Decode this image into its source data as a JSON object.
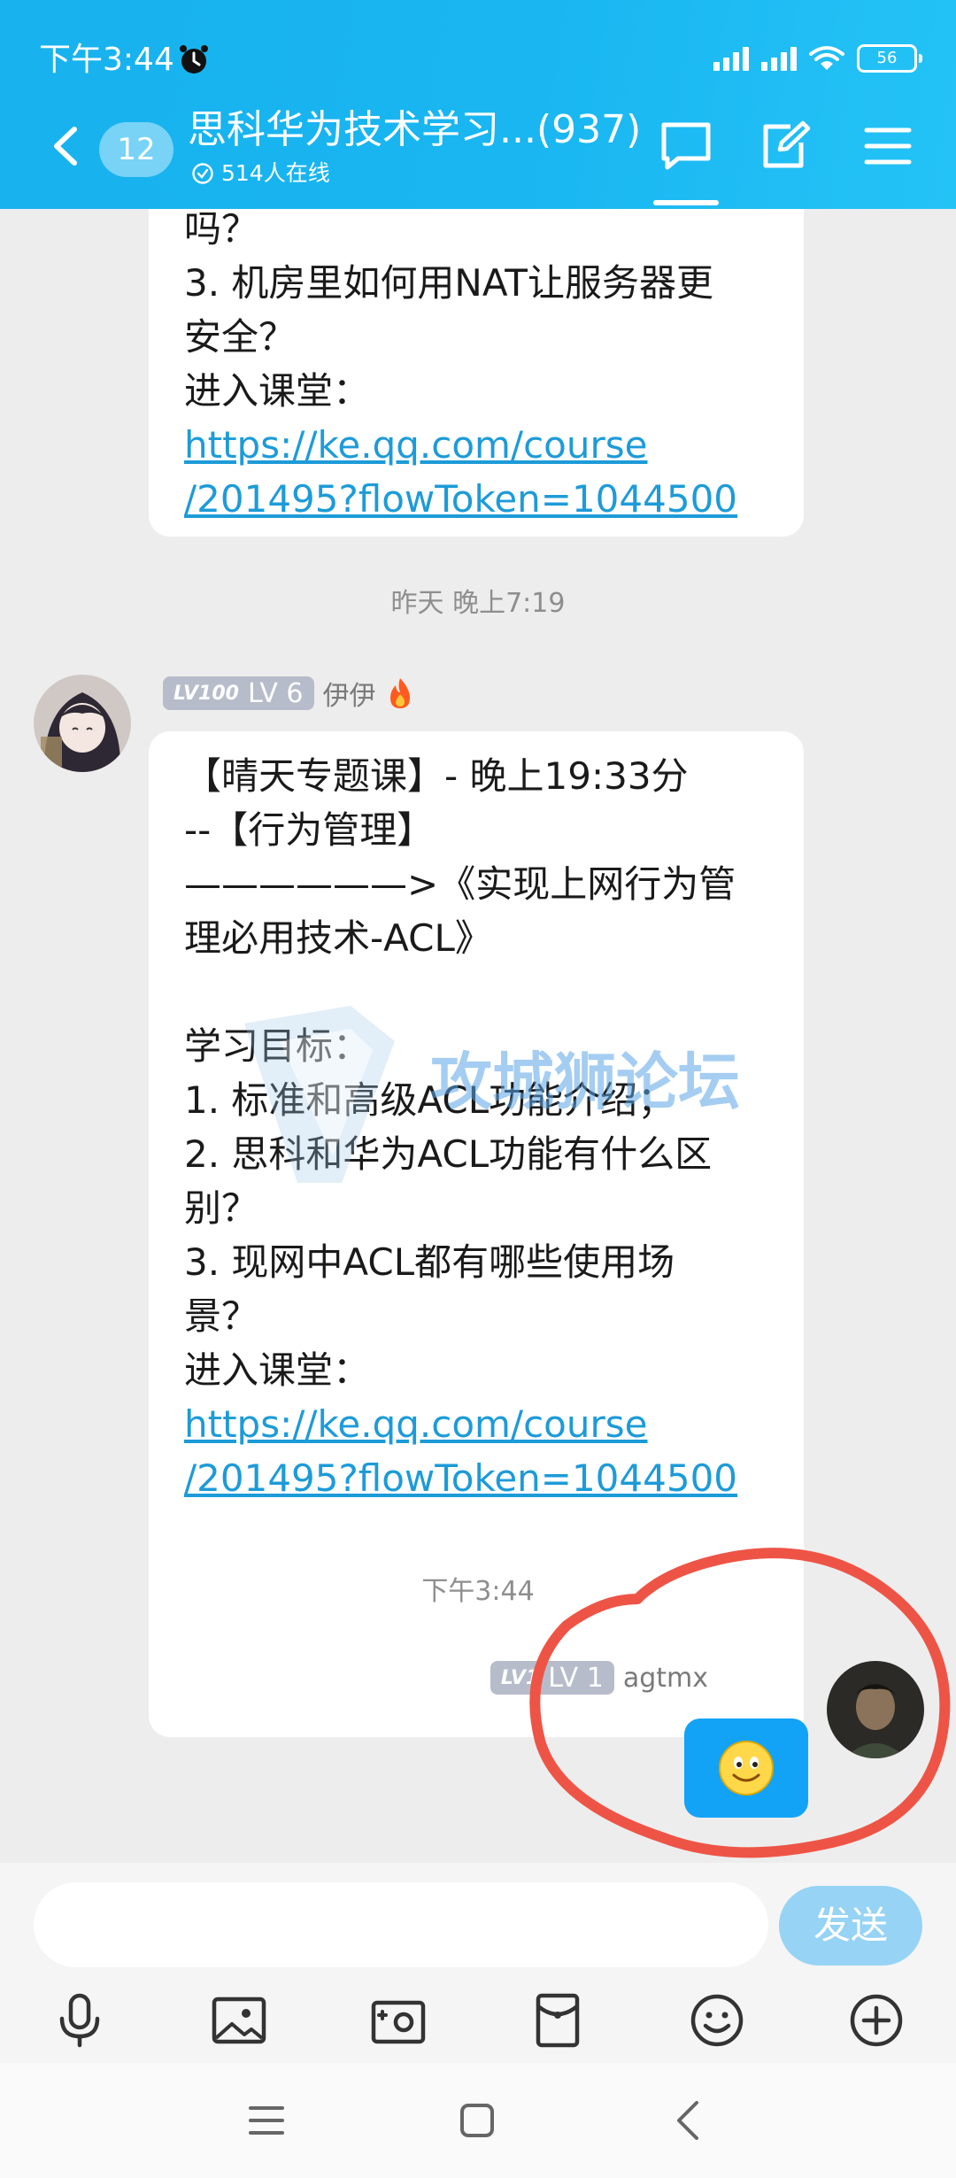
{
  "status_bar": {
    "time": "下午3:44",
    "battery": "56"
  },
  "header": {
    "unread_count": "12",
    "group_title": "思科华为技术学习...(937)",
    "online_text": "514人在线"
  },
  "messages": {
    "msg1_lines": [
      "吗？",
      "3. 机房里如何用NAT让服务器更",
      "安全？",
      "进入课堂："
    ],
    "msg1_link_lines": [
      "https://ke.qq.com/course",
      "/201495?flowToken=1044500"
    ],
    "timestamp1": "昨天 晚上7:19",
    "sender1": {
      "level_tag": "LV100",
      "level": "LV 6",
      "name": "伊伊"
    },
    "msg2_lines": [
      "【晴天专题课】- 晚上19:33分",
      "--【行为管理】",
      "——————>《实现上网行为管",
      "理必用技术-ACL》",
      "",
      "学习目标：",
      "1. 标准和高级ACL功能介绍；",
      "2. 思科和华为ACL功能有什么区",
      "别？",
      "3. 现网中ACL都有哪些使用场",
      "景？",
      "进入课堂："
    ],
    "msg2_link_lines": [
      "https://ke.qq.com/course",
      "/201495?flowToken=1044500"
    ],
    "timestamp2": "下午3:44",
    "sender2": {
      "level_tag": "LV1",
      "level": "LV 1",
      "name": "agtmx"
    }
  },
  "watermark": {
    "text": "攻城狮论坛"
  },
  "input": {
    "placeholder": "",
    "send_label": "发送"
  },
  "colors": {
    "header": "#19b6f1",
    "link": "#1d9bd8",
    "send": "#96d3f5",
    "emoji_bubble": "#12a3f7"
  }
}
